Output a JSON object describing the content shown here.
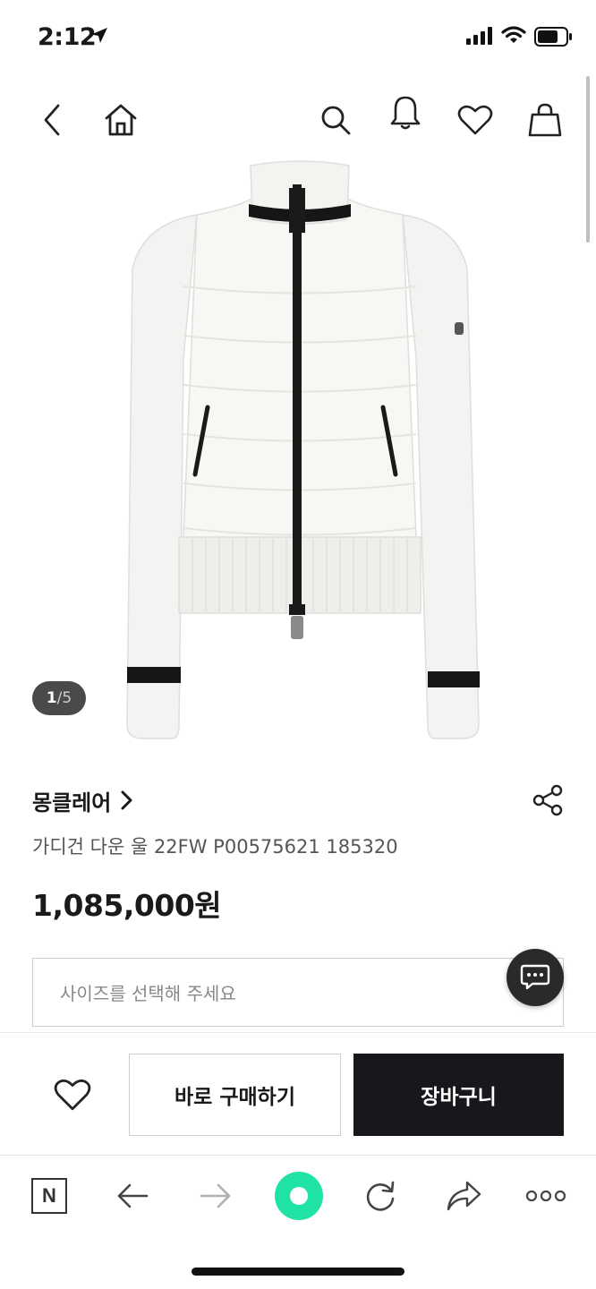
{
  "status_bar": {
    "time": "2:12"
  },
  "header": {
    "icons": [
      "back-icon",
      "home-icon",
      "search-icon",
      "bell-icon",
      "heart-icon",
      "shopping-bag-icon"
    ]
  },
  "gallery": {
    "current": "1",
    "separator": "/",
    "total": "5"
  },
  "product": {
    "brand": "몽클레어",
    "name": "가디건 다운 울 22FW P00575621 185320",
    "price": "1,085,000원"
  },
  "size_select": {
    "placeholder": "사이즈를 선택해 주세요"
  },
  "purchase_bar": {
    "buy_now_label": "바로 구매하기",
    "cart_label": "장바구니"
  },
  "browser_toolbar": {
    "naver_label": "N",
    "icons": [
      "naver-icon",
      "back-arrow-icon",
      "forward-arrow-icon",
      "green-circle-icon",
      "reload-icon",
      "share-arrow-icon",
      "more-icon"
    ]
  },
  "colors": {
    "cart_button": "#16181b",
    "green_button": "#1ee3a4",
    "counter_badge": "#4a4a4a"
  }
}
